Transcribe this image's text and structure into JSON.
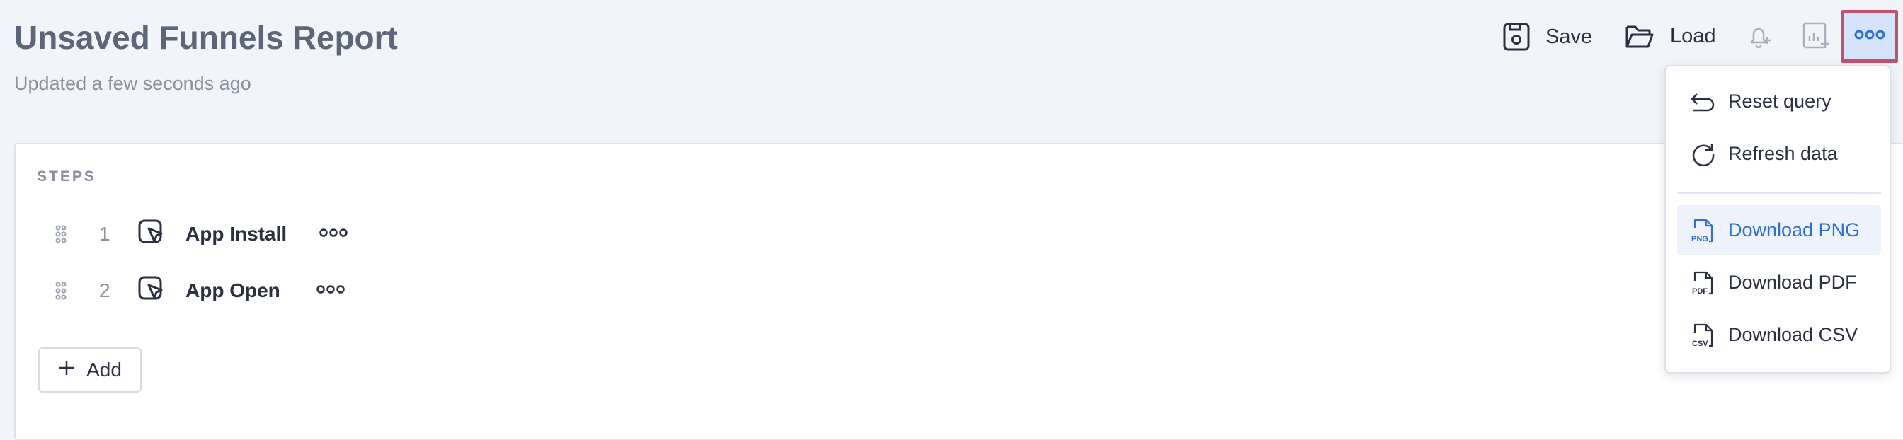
{
  "header": {
    "title": "Unsaved Funnels Report",
    "subtitle": "Updated a few seconds ago"
  },
  "toolbar": {
    "save_label": "Save",
    "load_label": "Load",
    "icons": [
      "save-icon",
      "folder-icon",
      "bell-plus-icon",
      "chart-plus-icon",
      "more-icon"
    ]
  },
  "steps": {
    "label": "STEPS",
    "items": [
      {
        "number": "1",
        "name": "App Install"
      },
      {
        "number": "2",
        "name": "App Open"
      }
    ],
    "add_label": "Add"
  },
  "menu": {
    "items": [
      {
        "label": "Reset query",
        "icon": "undo-icon"
      },
      {
        "label": "Refresh data",
        "icon": "refresh-icon"
      },
      {
        "label": "Download PNG",
        "icon": "png-file-icon",
        "highlighted": true
      },
      {
        "label": "Download PDF",
        "icon": "pdf-file-icon"
      },
      {
        "label": "Download CSV",
        "icon": "csv-file-icon"
      }
    ]
  },
  "colors": {
    "accent": "#2e6fd8",
    "highlight_border": "#c4516c",
    "background": "#f1f4f9"
  }
}
